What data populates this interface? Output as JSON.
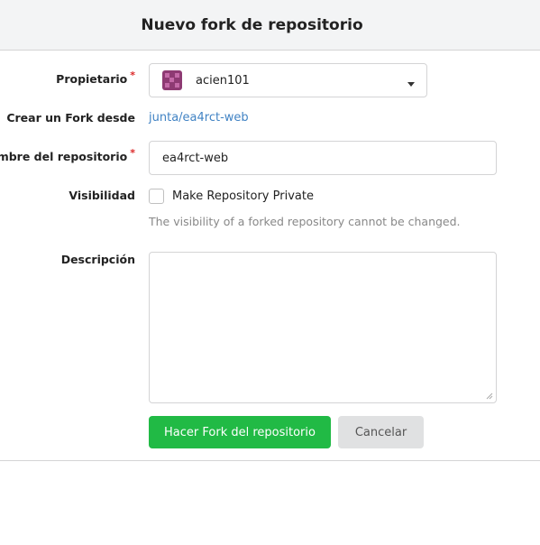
{
  "header": {
    "title": "Nuevo fork de repositorio"
  },
  "form": {
    "owner": {
      "label": "Propietario",
      "required_mark": "*",
      "value": "acien101",
      "avatar_icon": "user-avatar-icon"
    },
    "fork_from": {
      "label": "Crear un Fork desde",
      "link_text": "junta/ea4rct-web"
    },
    "repo_name": {
      "label": "Nombre del repositorio",
      "required_mark": "*",
      "value": "ea4rct-web"
    },
    "visibility": {
      "label": "Visibilidad",
      "checkbox_label": "Make Repository Private",
      "checked": false,
      "help_text": "The visibility of a forked repository cannot be changed."
    },
    "description": {
      "label": "Descripción",
      "value": ""
    }
  },
  "actions": {
    "submit_label": "Hacer Fork del repositorio",
    "cancel_label": "Cancelar"
  },
  "colors": {
    "primary": "#21ba45",
    "link": "#4183c4",
    "required": "#db2828",
    "avatar": "#8e3a73"
  }
}
